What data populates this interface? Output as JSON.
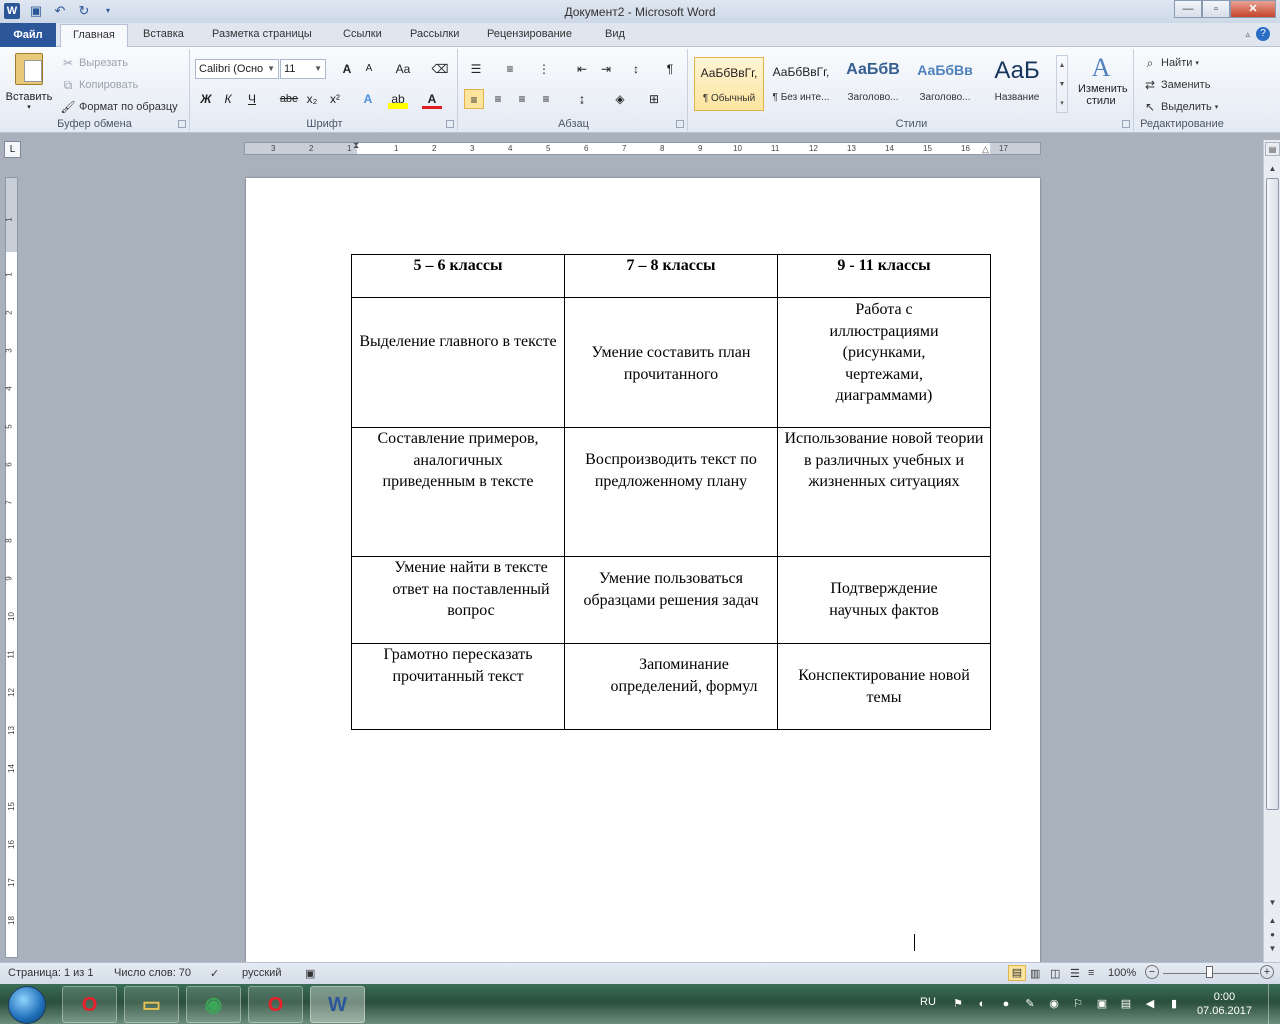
{
  "titlebar": {
    "title": "Документ2 - Microsoft Word",
    "app_icon": "word-logo-icon",
    "minimize": "—",
    "restore": "▫",
    "close": "✕"
  },
  "tabs": [
    "Файл",
    "Главная",
    "Вставка",
    "Разметка страницы",
    "Ссылки",
    "Рассылки",
    "Рецензирование",
    "Вид"
  ],
  "ribbon": {
    "clipboard": {
      "paste": "Вставить",
      "cut": "Вырезать",
      "copy": "Копировать",
      "format_painter": "Формат по образцу",
      "label": "Буфер обмена"
    },
    "font": {
      "family": "Calibri (Осно",
      "size": "11",
      "grow": "A",
      "shrink": "A",
      "case": "Aa",
      "bold": "Ж",
      "italic": "К",
      "underline": "Ч",
      "strike": "abe",
      "subscript": "x₂",
      "superscript": "x²",
      "label": "Шрифт"
    },
    "paragraph": {
      "label": "Абзац",
      "pilcrow": "¶"
    },
    "styles": {
      "label": "Стили",
      "items": [
        {
          "preview": "АаБбВвГг,",
          "name": "¶ Обычный"
        },
        {
          "preview": "АаБбВвГг,",
          "name": "¶ Без инте..."
        },
        {
          "preview": "АаБбВ",
          "name": "Заголово..."
        },
        {
          "preview": "АаБбВв",
          "name": "Заголово..."
        },
        {
          "preview": "АаБ",
          "name": "Название"
        }
      ],
      "change_styles": "Изменить стили"
    },
    "editing": {
      "label": "Редактирование",
      "find": "Найти",
      "replace": "Заменить",
      "select": "Выделить"
    }
  },
  "ruler": {
    "h_numbers": [
      "3",
      "2",
      "1",
      "1",
      "2",
      "3",
      "4",
      "5",
      "6",
      "7",
      "8",
      "9",
      "10",
      "11",
      "12",
      "13",
      "14",
      "15",
      "16",
      "17"
    ],
    "v_numbers": [
      "1",
      "1",
      "2",
      "3",
      "4",
      "5",
      "6",
      "7",
      "8",
      "9",
      "10",
      "11",
      "12",
      "13",
      "14",
      "15",
      "16",
      "17",
      "18"
    ]
  },
  "document": {
    "table": {
      "header": [
        "5 – 6 классы",
        "7 – 8 классы",
        "9  - 11 классы"
      ],
      "rows": [
        [
          "Выделение главного в тексте",
          "Умение составить план прочитанного",
          "Работа с иллюстрациями (рисунками, чертежами, диаграммами)"
        ],
        [
          "Составление примеров, аналогичных приведенным в тексте",
          "Воспроизводить текст по предложенному плану",
          "Использование новой теории в различных учебных и жизненных ситуациях"
        ],
        [
          "Умение найти в тексте ответ на поставленный вопрос",
          "Умение пользоваться образцами решения задач",
          "Подтверждение научных фактов"
        ],
        [
          "Грамотно пересказать прочитанный текст",
          "Запоминание определений, формул",
          "Конспектирование новой темы"
        ]
      ]
    }
  },
  "status": {
    "page": "Страница: 1 из 1",
    "words": "Число слов: 70",
    "language": "русский",
    "zoom": "100%"
  },
  "taskbar": {
    "lang": "RU",
    "time": "0:00",
    "date": "07.06.2017",
    "apps": [
      "opera-icon",
      "file-explorer-icon",
      "chrome-icon",
      "opera-icon",
      "word-icon"
    ]
  }
}
